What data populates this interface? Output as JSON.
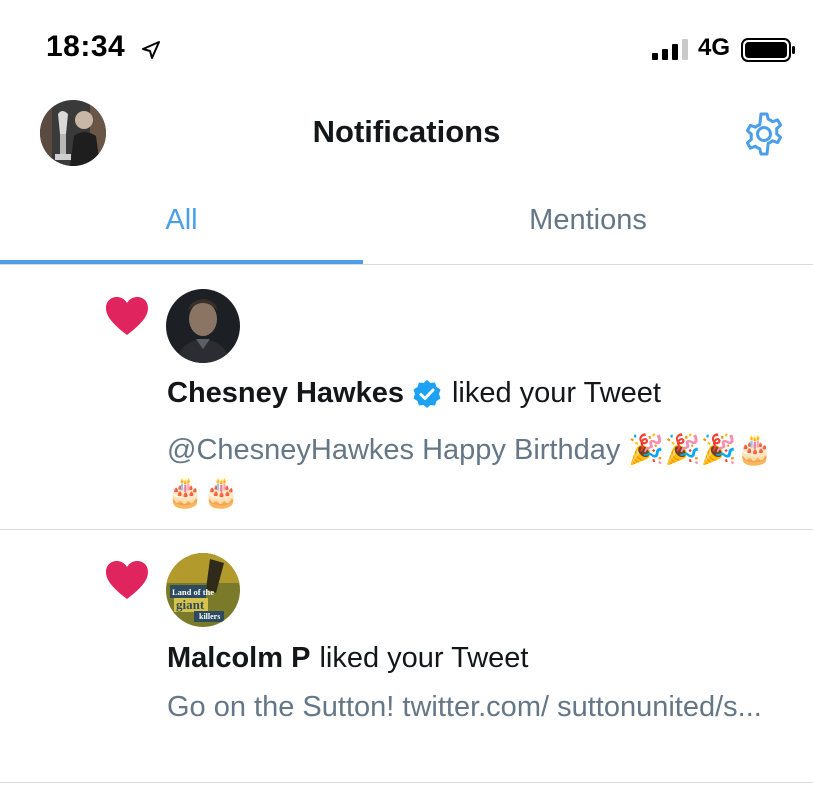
{
  "status_bar": {
    "time": "18:34",
    "network": "4G",
    "icons": [
      "location-arrow-icon",
      "signal-icon",
      "battery-icon"
    ]
  },
  "header": {
    "title": "Notifications",
    "settings_icon": "gear-icon"
  },
  "tabs": [
    {
      "label": "All",
      "active": true
    },
    {
      "label": "Mentions",
      "active": false
    }
  ],
  "notifications": [
    {
      "type": "like",
      "actor": "Chesney Hawkes",
      "verified": true,
      "action": "liked your Tweet",
      "tweet_text": "@ChesneyHawkes Happy Birthday 🎉🎉🎉🎂🎂🎂"
    },
    {
      "type": "like",
      "actor": "Malcolm P",
      "verified": false,
      "action": "liked your Tweet",
      "tweet_text": "Go on the Sutton! twitter.com/ suttonunited/s...",
      "avatar_text": {
        "line1": "Land of the",
        "line2": "giant",
        "line3": "killers"
      }
    }
  ],
  "colors": {
    "accent": "#4a9fe8",
    "heart": "#e0245e",
    "secondary_text": "#657786",
    "divider": "#d7dbdf",
    "verified": "#1da1f2"
  }
}
